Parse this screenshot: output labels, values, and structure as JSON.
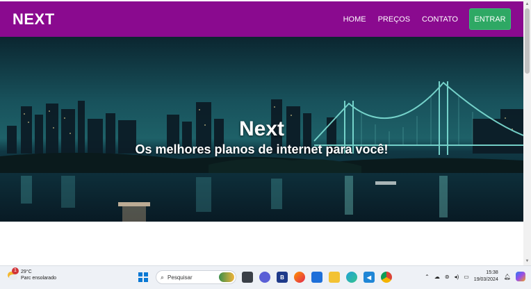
{
  "navbar": {
    "brand": "NEXT",
    "links": [
      "HOME",
      "PREÇOS",
      "CONTATO"
    ],
    "cta": "ENTRAR"
  },
  "hero": {
    "title": "Next",
    "subtitle": "Os melhores planos de internet para você!"
  },
  "taskbar": {
    "weather_temp": "29°C",
    "weather_desc": "Parc ensolarado",
    "weather_badge": "1",
    "search_placeholder": "Pesquisar",
    "time": "15:38",
    "date": "19/03/2024"
  },
  "colors": {
    "navbar": "#8a0a8f",
    "cta": "#2ea864"
  }
}
